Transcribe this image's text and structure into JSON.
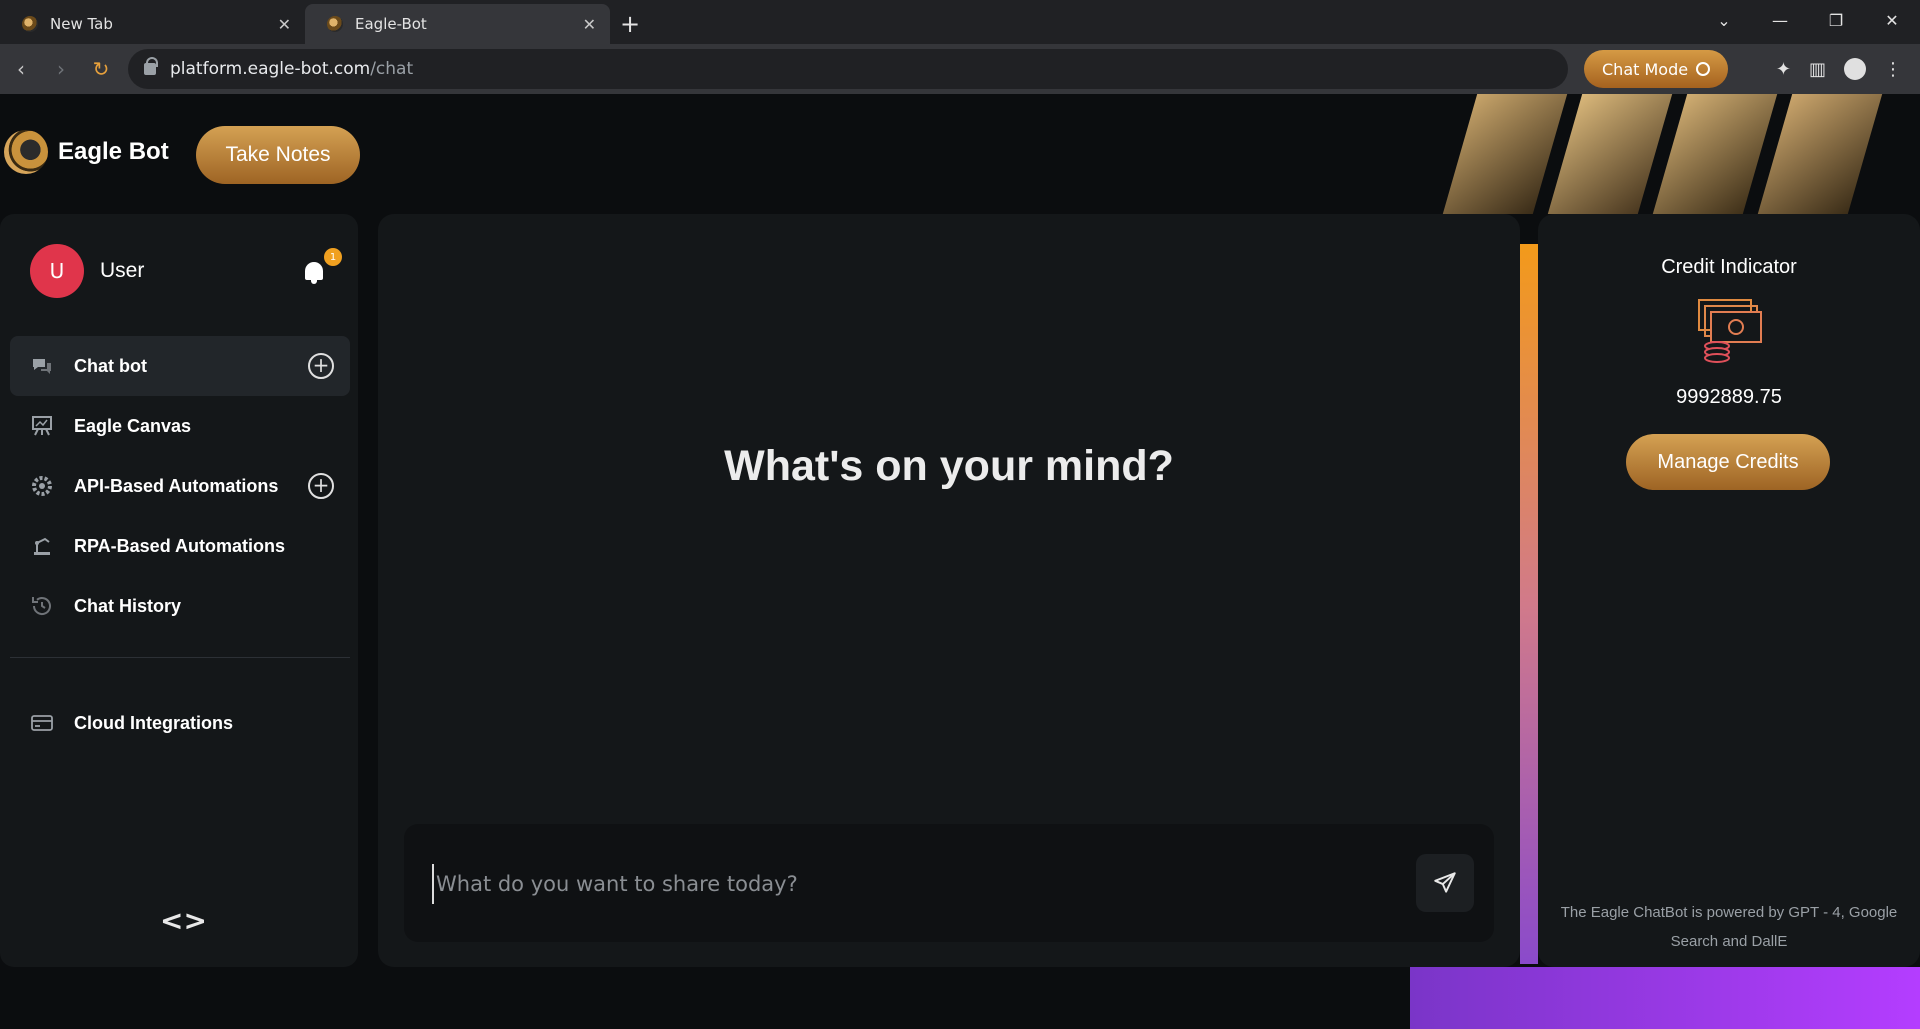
{
  "browser": {
    "tabs": [
      {
        "title": "New Tab",
        "active": false
      },
      {
        "title": "Eagle-Bot",
        "active": true
      }
    ],
    "url_host": "platform.eagle-bot.com",
    "url_path": "/chat",
    "chat_mode_label": "Chat Mode"
  },
  "app": {
    "brand_name": "Eagle Bot",
    "take_notes_label": "Take Notes",
    "user": {
      "initial": "U",
      "name": "User",
      "notification_count": "1"
    },
    "nav": [
      {
        "label": "Chat bot",
        "icon": "chat-icon",
        "has_add": true,
        "active": true
      },
      {
        "label": "Eagle Canvas",
        "icon": "canvas-icon",
        "has_add": false,
        "active": false
      },
      {
        "label": "API-Based Automations",
        "icon": "gear-icon",
        "has_add": true,
        "active": false
      },
      {
        "label": "RPA-Based Automations",
        "icon": "robot-arm-icon",
        "has_add": false,
        "active": false
      },
      {
        "label": "Chat History",
        "icon": "history-icon",
        "has_add": false,
        "active": false
      }
    ],
    "cloud_label": "Cloud Integrations",
    "collapse_glyph": "<>",
    "headline": "What's on your mind?",
    "composer_placeholder": "What do you want to share today?",
    "credit": {
      "title": "Credit Indicator",
      "value": "9992889.75",
      "manage_label": "Manage Credits"
    },
    "powered_by": "The Eagle ChatBot is powered by GPT - 4, Google Search and DallE"
  },
  "colors": {
    "accent_gold": "#c9893a",
    "avatar_red": "#e0354b",
    "badge_orange": "#f0a020",
    "panel_bg": "#141719"
  }
}
